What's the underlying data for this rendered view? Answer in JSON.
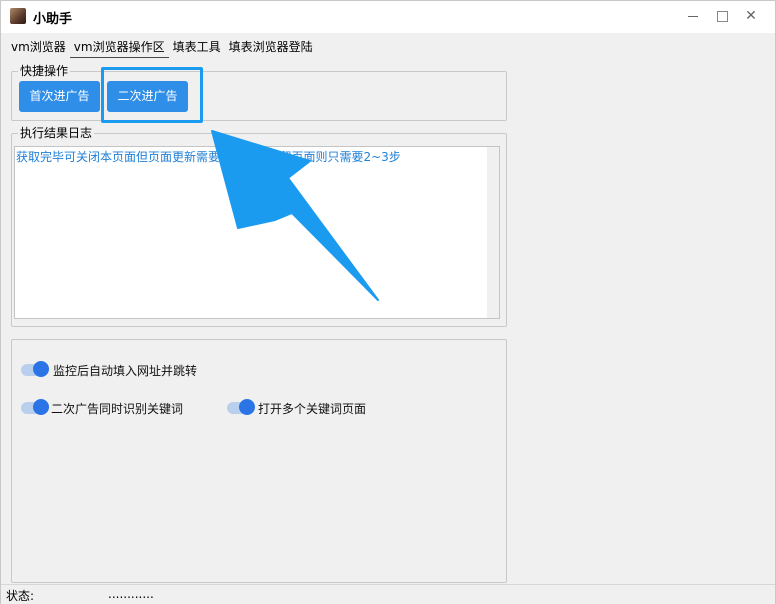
{
  "window": {
    "title": "小助手"
  },
  "tabs": [
    {
      "label": "vm浏览器"
    },
    {
      "label": "vm浏览器操作区"
    },
    {
      "label": "填表工具"
    },
    {
      "label": "填表浏览器登陆"
    }
  ],
  "quick_ops": {
    "title": "快捷操作",
    "first_button": "首次进广告",
    "second_button": "二次进广告"
  },
  "log": {
    "title": "执行结果日志",
    "text": "获取完毕可关闭本页面但页面更新需要                         5步流程保留页面则只需要2~3步"
  },
  "options": {
    "auto_fill": "监控后自动填入网址并跳转",
    "detect_keywords": "二次广告同时识别关键词",
    "open_pages": "打开多个关键词页面"
  },
  "status": {
    "label": "状态:",
    "value": "............"
  },
  "colors": {
    "accent": "#2f8ee8",
    "highlight": "#1a9bf0",
    "log_text": "#1f7fd6"
  }
}
